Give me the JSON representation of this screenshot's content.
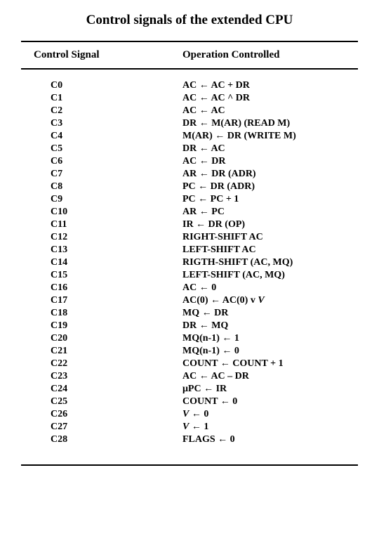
{
  "title": "Control signals of the extended CPU",
  "headers": {
    "left": "Control Signal",
    "right": "Operation Controlled"
  },
  "chart_data": {
    "type": "table",
    "title": "Control signals of the extended CPU",
    "columns": [
      "Control Signal",
      "Operation Controlled"
    ],
    "rows": [
      {
        "signal": "C0",
        "op": "AC ← AC + DR"
      },
      {
        "signal": "C1",
        "op": "AC ← AC ^ DR"
      },
      {
        "signal": "C2",
        "op": "AC ← AC"
      },
      {
        "signal": "C3",
        "op": "DR ← M(AR) (READ M)"
      },
      {
        "signal": "C4",
        "op": "M(AR) ← DR (WRITE M)"
      },
      {
        "signal": "C5",
        "op": "DR ← AC"
      },
      {
        "signal": "C6",
        "op": "AC ← DR"
      },
      {
        "signal": "C7",
        "op": "AR ← DR (ADR)"
      },
      {
        "signal": "C8",
        "op": "PC ← DR (ADR)"
      },
      {
        "signal": "C9",
        "op": "PC ← PC + 1"
      },
      {
        "signal": "C10",
        "op": "AR ← PC"
      },
      {
        "signal": "C11",
        "op": "IR ← DR (OP)"
      },
      {
        "signal": "C12",
        "op": "RIGHT-SHIFT AC"
      },
      {
        "signal": "C13",
        "op": "LEFT-SHIFT AC"
      },
      {
        "signal": "C14",
        "op": "RIGTH-SHIFT (AC, MQ)"
      },
      {
        "signal": "C15",
        "op": "LEFT-SHIFT (AC, MQ)"
      },
      {
        "signal": "C16",
        "op": "AC ← 0"
      },
      {
        "signal": "C17",
        "op": "AC(0) ← AC(0) v V",
        "italic_last": true
      },
      {
        "signal": "C18",
        "op": "MQ ← DR"
      },
      {
        "signal": "C19",
        "op": "DR ← MQ"
      },
      {
        "signal": "C20",
        "op": "MQ(n-1) ← 1"
      },
      {
        "signal": "C21",
        "op": "MQ(n-1) ← 0"
      },
      {
        "signal": "C22",
        "op": "COUNT ← COUNT + 1"
      },
      {
        "signal": "C23",
        "op": "AC ← AC – DR"
      },
      {
        "signal": "C24",
        "op": "μPC ← IR"
      },
      {
        "signal": "C25",
        "op": "COUNT ← 0"
      },
      {
        "signal": "C26",
        "op": "V ← 0",
        "italic_first": true
      },
      {
        "signal": "C27",
        "op": "V ← 1",
        "italic_first": true
      },
      {
        "signal": "C28",
        "op": "FLAGS ← 0"
      }
    ]
  }
}
